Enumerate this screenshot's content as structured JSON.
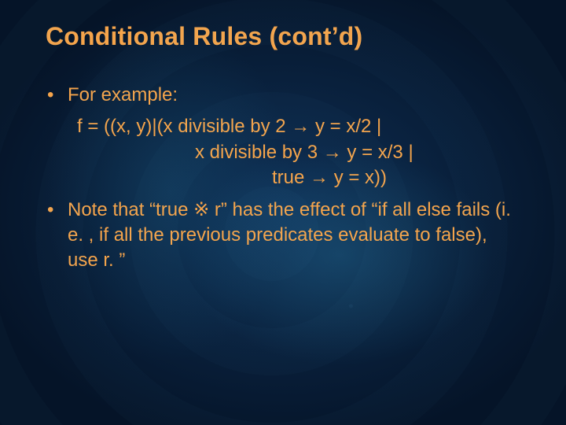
{
  "title": "Conditional Rules (cont’d)",
  "bullets": {
    "b1": "For example:",
    "b2": "Note that “true ※ r” has the effect of “if all else fails (i. e. , if all the previous predicates evaluate to false), use r. ”"
  },
  "example": {
    "line1": "f = ((x, y)|(x divisible by 2 → y = x/2 |",
    "line2": "x divisible by 3 → y = x/3 |",
    "line3": "true →  y = x))"
  }
}
